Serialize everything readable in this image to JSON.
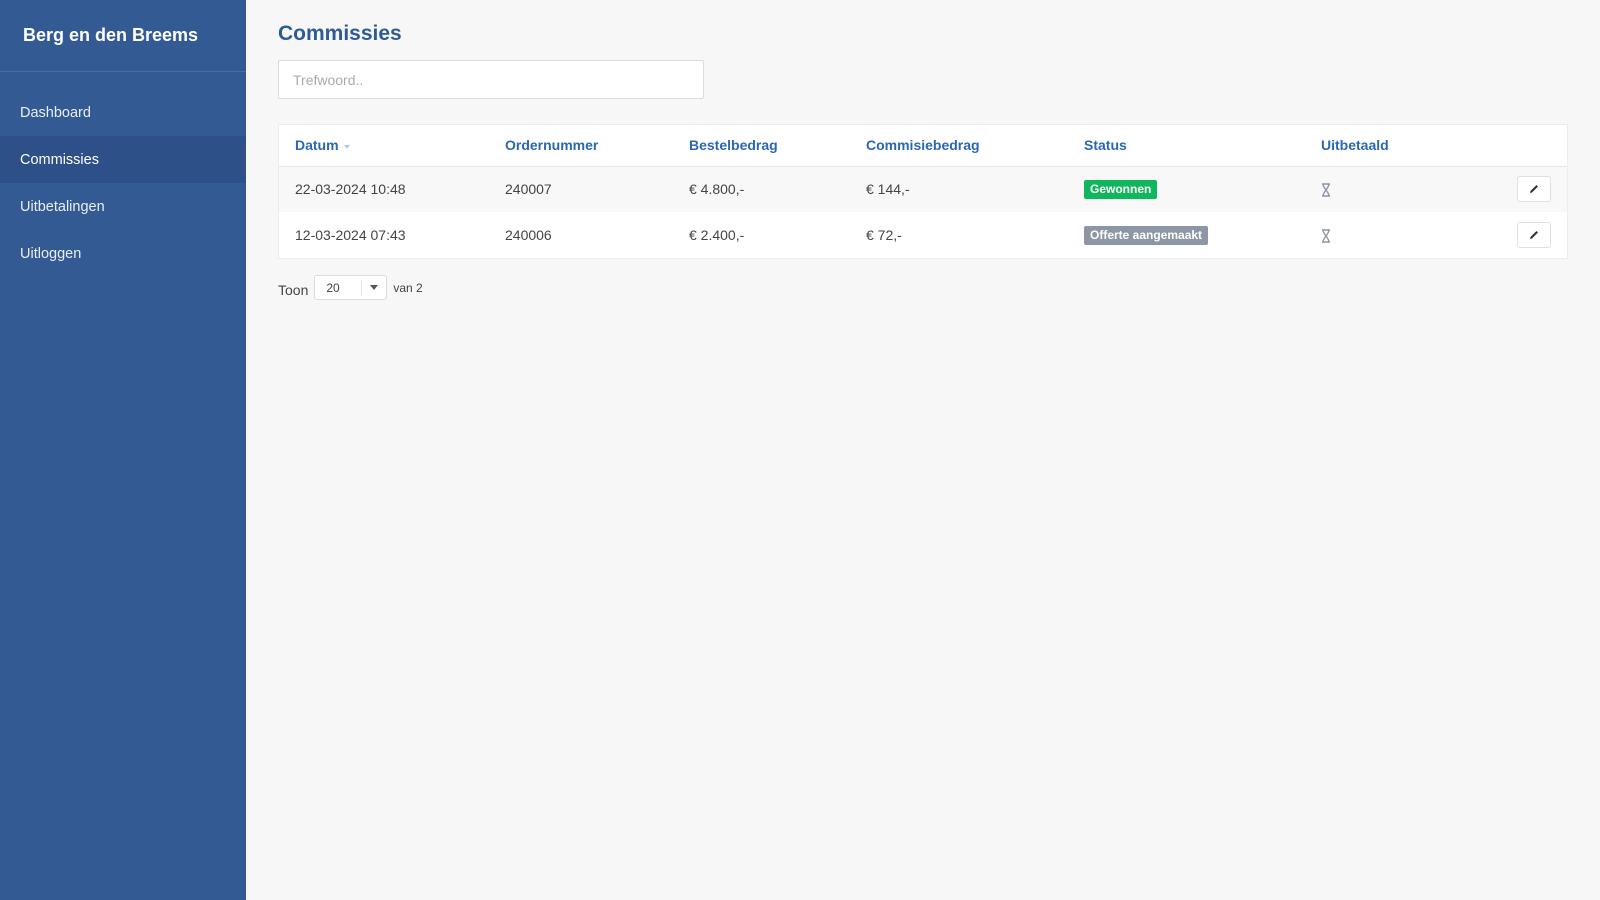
{
  "sidebar": {
    "brand": "Berg en den Breems",
    "items": [
      {
        "label": "Dashboard"
      },
      {
        "label": "Commissies"
      },
      {
        "label": "Uitbetalingen"
      },
      {
        "label": "Uitloggen"
      }
    ]
  },
  "main": {
    "title": "Commissies",
    "search_placeholder": "Trefwoord..",
    "table": {
      "headers": {
        "datum": "Datum",
        "ordernummer": "Ordernummer",
        "bestelbedrag": "Bestelbedrag",
        "commissiebedrag": "Commisiebedrag",
        "status": "Status",
        "uitbetaald": "Uitbetaald"
      },
      "rows": [
        {
          "datum": "22-03-2024 10:48",
          "ordernummer": "240007",
          "bestelbedrag": "€ 4.800,-",
          "commissiebedrag": "€ 144,-",
          "status": "Gewonnen",
          "status_color": "#10b65d",
          "uitbetaald_icon": "hourglass-icon"
        },
        {
          "datum": "12-03-2024 07:43",
          "ordernummer": "240006",
          "bestelbedrag": "€ 2.400,-",
          "commissiebedrag": "€ 72,-",
          "status": "Offerte aangemaakt",
          "status_color": "#8c96a5",
          "uitbetaald_icon": "hourglass-icon"
        }
      ]
    },
    "pager": {
      "label": "Toon",
      "per_page": "20",
      "total": "van 2"
    }
  },
  "colors": {
    "sidebar_bg": "#335a92",
    "accent": "#2b67b3",
    "title": "#2f5b93"
  }
}
